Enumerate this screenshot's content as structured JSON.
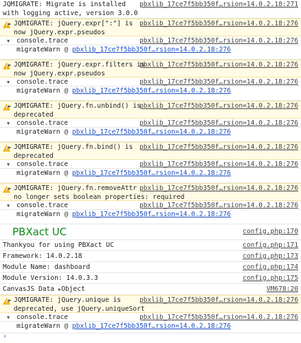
{
  "rows": [
    {
      "text": "JQMIGRATE: Migrate is installed\nwith logging active, version 3.0.0",
      "src": "pbxlib_17ce7f5bb350f…rsion=14.0.2.18:271"
    },
    {
      "text": "JQMIGRATE: jQuery.expr[\":\"] is\nnow jQuery.expr.pseudos",
      "src": "pbxlib_17ce7f5bb350f…rsion=14.0.2.18:276"
    },
    {
      "text": "JQMIGRATE: jQuery.expr.filters is\nnow jQuery.expr.pseudos",
      "src": "pbxlib_17ce7f5bb350f…rsion=14.0.2.18:276"
    },
    {
      "text": "JQMIGRATE: jQuery.fn.unbind() is\ndeprecated",
      "src": "pbxlib_17ce7f5bb350f…rsion=14.0.2.18:276"
    },
    {
      "text": "JQMIGRATE: jQuery.fn.bind() is\ndeprecated",
      "src": "pbxlib_17ce7f5bb350f…rsion=14.0.2.18:276"
    },
    {
      "text": "JQMIGRATE: jQuery.fn.removeAttr\nno longer sets boolean properties: required",
      "src": "pbxlib_17ce7f5bb350f…rsion=14.0.2.18:276"
    },
    {
      "text": "JQMIGRATE: jQuery.unique is\ndeprecated, use jQuery.uniqueSort",
      "src": "pbxlib_17ce7f5bb350f…rsion=14.0.2.18:276"
    }
  ],
  "trace": {
    "label": "console.trace",
    "src": "pbxlib_17ce7f5bb350f…rsion=14.0.2.18:276",
    "fn": "migrateWarn",
    "at": "@",
    "link": "pbxlib_17ce7f5bb350f…rsion=14.0.2.18:276"
  },
  "pbx": {
    "title": "PBXact UC",
    "title_src": "config.php:170",
    "lines": [
      {
        "text": "Thankyou for using PBXact UC",
        "src": "config.php:171"
      },
      {
        "text": "Framework: 14.0.2.18",
        "src": "config.php:173"
      },
      {
        "text": "Module Name: dashboard",
        "src": "config.php:174"
      },
      {
        "text": "Module Version: 14.0.3.3",
        "src": "config.php:175"
      }
    ]
  },
  "canvas": {
    "label": "CanvasJS Data",
    "value": "Object",
    "src": "VM678:20"
  },
  "prompt": "›",
  "colors": {
    "warn_bg": "#fffbe5",
    "warn_icon": "#f2b400",
    "link": "#1a4ec0",
    "green": "#0e8a1a",
    "prompt": "#1a73e8"
  }
}
